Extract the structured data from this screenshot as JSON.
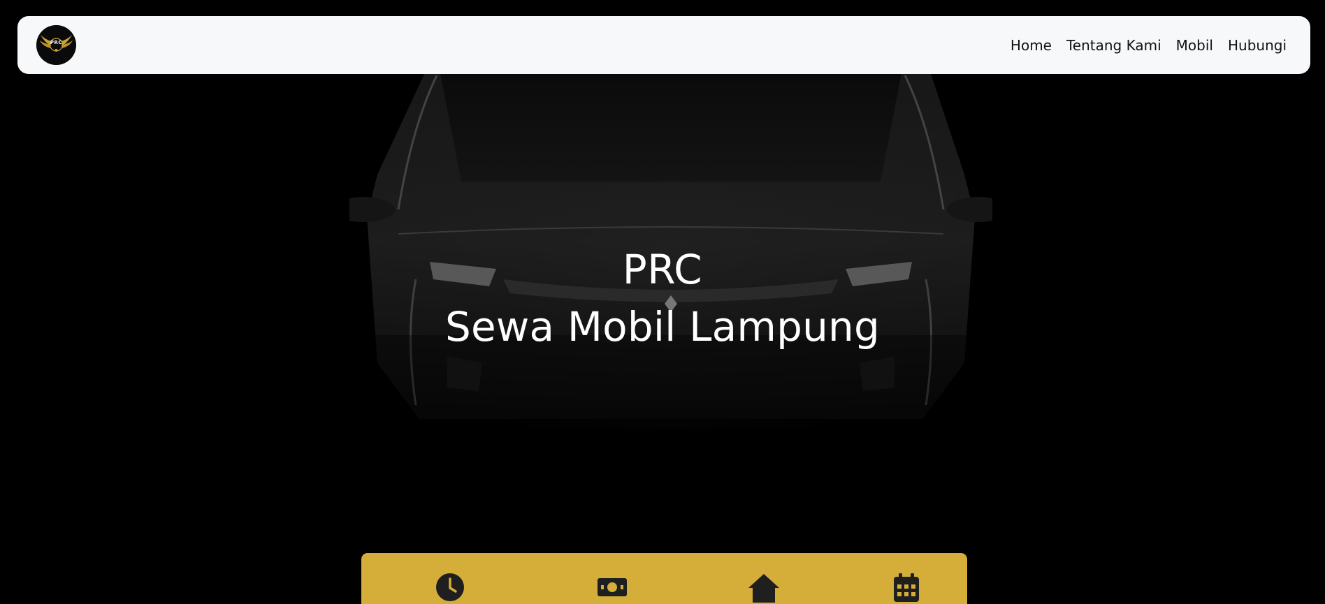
{
  "brand": {
    "logo_text": "PRC",
    "accent_color": "#d4ae38"
  },
  "nav": {
    "items": [
      {
        "label": "Home"
      },
      {
        "label": "Tentang Kami"
      },
      {
        "label": "Mobil"
      },
      {
        "label": "Hubungi"
      }
    ]
  },
  "hero": {
    "title": "PRC",
    "subtitle": "Sewa Mobil Lampung"
  },
  "features": {
    "icons": [
      "clock-icon",
      "money-icon",
      "home-icon",
      "calendar-icon"
    ]
  }
}
